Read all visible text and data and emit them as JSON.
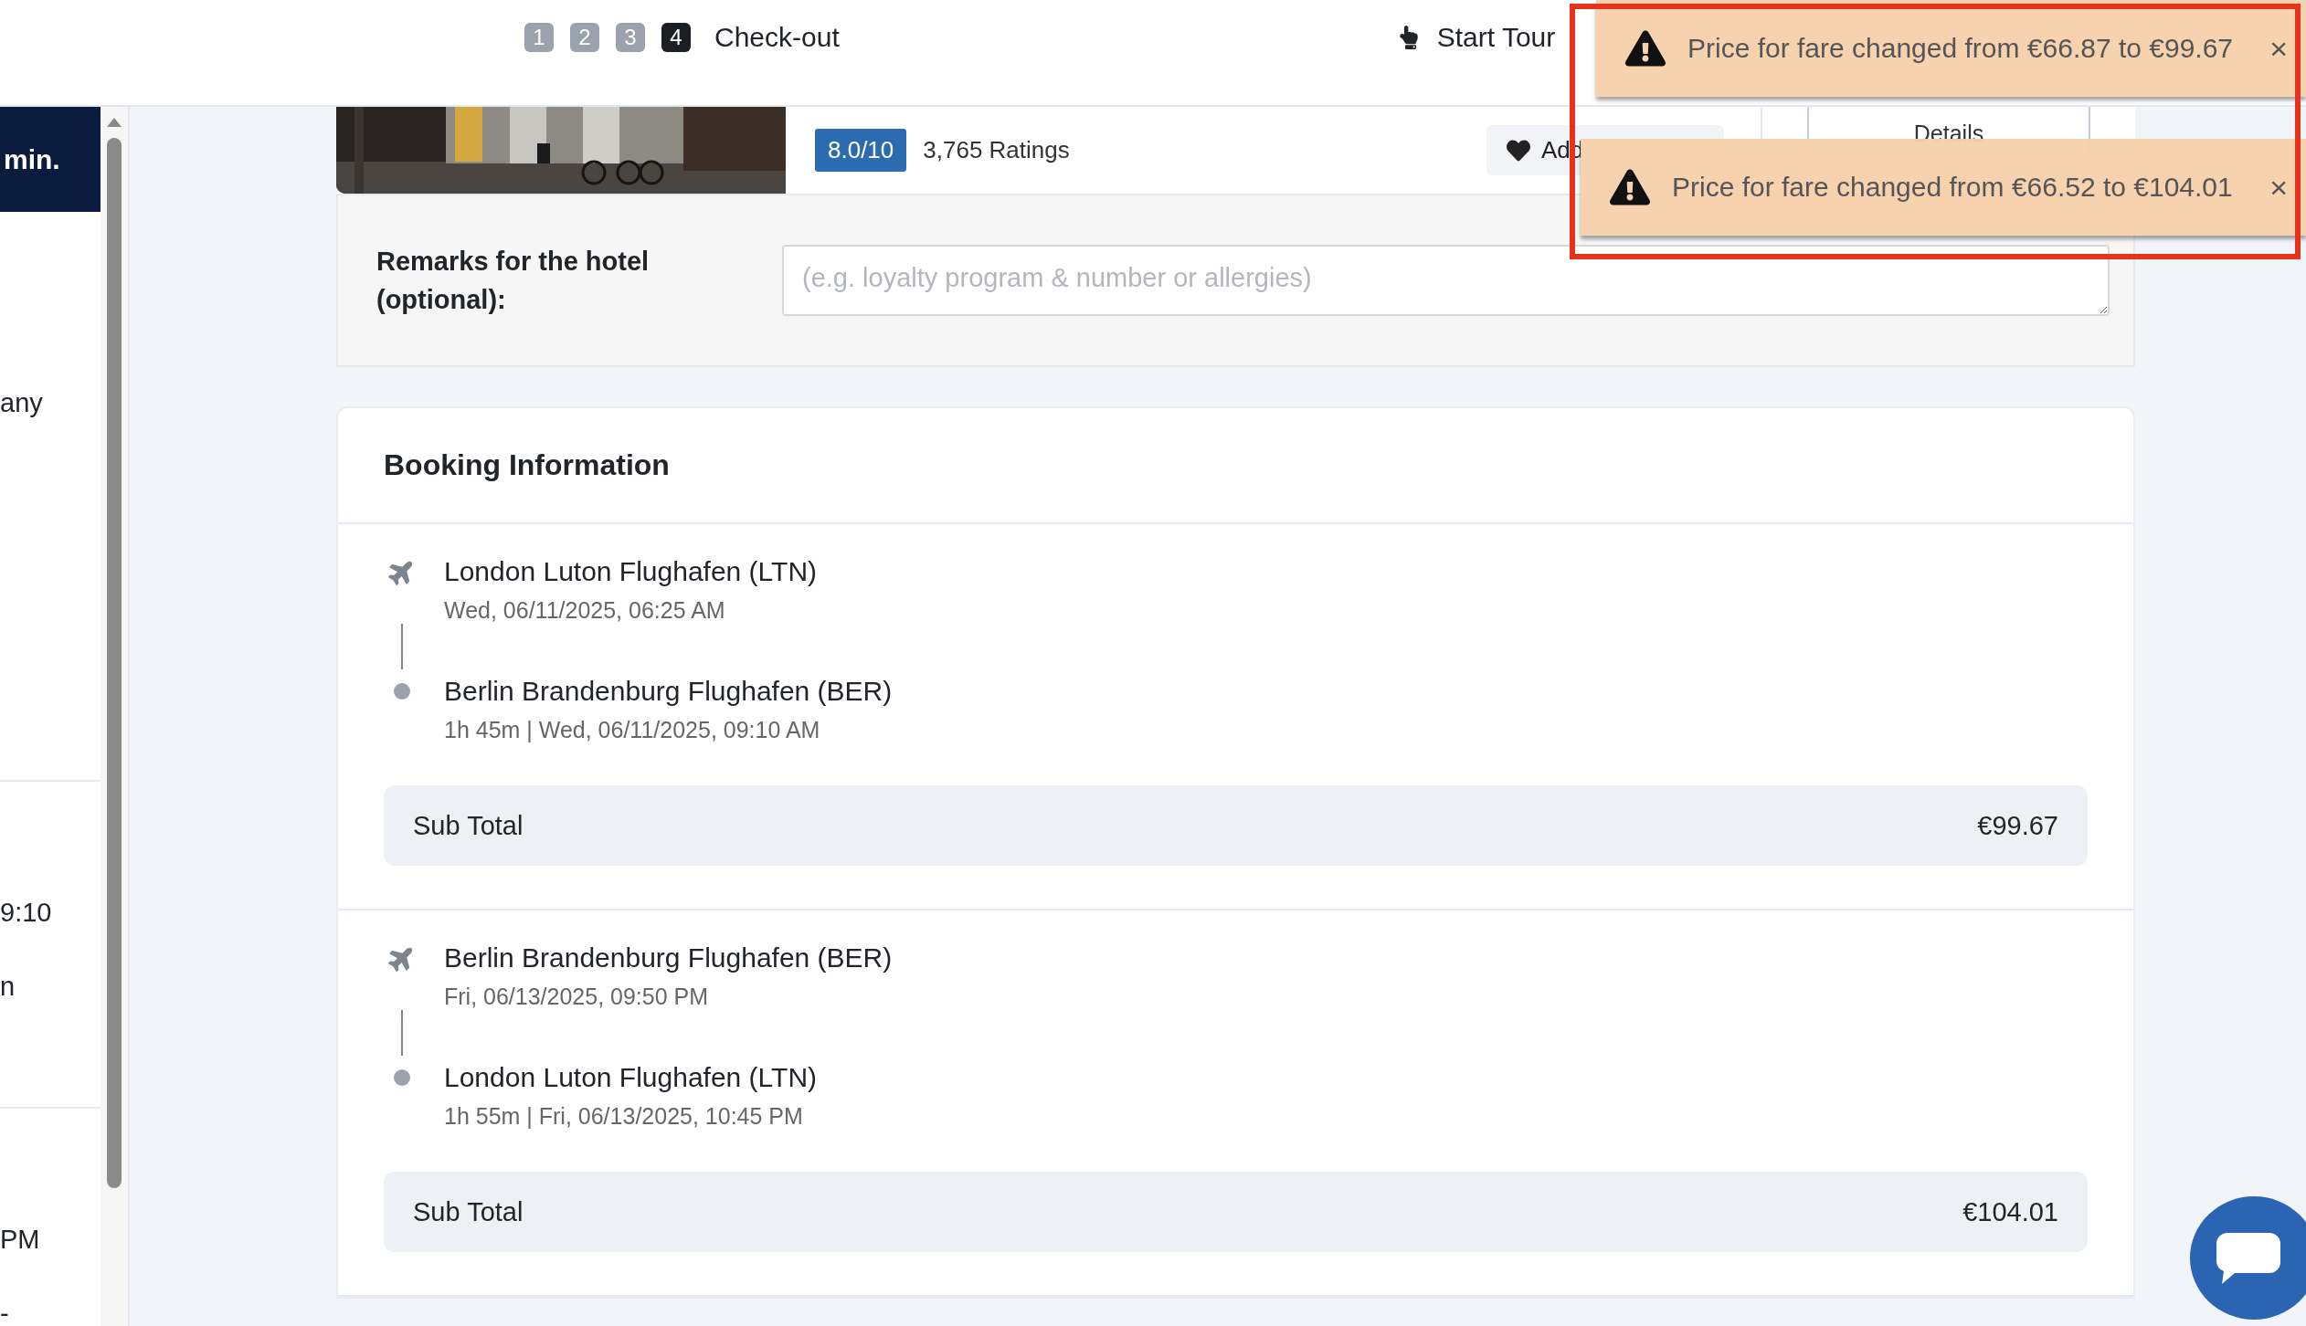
{
  "header": {
    "steps": [
      {
        "label": "1",
        "selected": false
      },
      {
        "label": "2",
        "selected": false
      },
      {
        "label": "3",
        "selected": false
      },
      {
        "label": "4",
        "selected": true
      }
    ],
    "current_step": "Check-out",
    "tour_button": "Start Tour"
  },
  "sidebar": {
    "banner": "min.",
    "sections": [
      {
        "lines": [
          "any"
        ]
      },
      {
        "lines": [
          "9:10",
          "n"
        ]
      },
      {
        "lines": [
          "PM",
          "-"
        ]
      }
    ]
  },
  "hotel": {
    "rating": "8.0/10",
    "ratings_count": "3,765 Ratings",
    "favorite_button": "Add",
    "details_button": "Details"
  },
  "remarks": {
    "label": "Remarks for the hotel (optional):",
    "placeholder": "(e.g. loyalty program & number or allergies)"
  },
  "booking": {
    "title": "Booking Information",
    "segments": [
      {
        "departure": {
          "airport": "London Luton Flughafen (LTN)",
          "time": "Wed, 06/11/2025, 06:25 AM"
        },
        "arrival": {
          "airport": "Berlin Brandenburg Flughafen (BER)",
          "time": "1h 45m | Wed, 06/11/2025, 09:10 AM"
        },
        "subtotal_label": "Sub Total",
        "subtotal": "€99.67"
      },
      {
        "departure": {
          "airport": "Berlin Brandenburg Flughafen (BER)",
          "time": "Fri, 06/13/2025, 09:50 PM"
        },
        "arrival": {
          "airport": "London Luton Flughafen (LTN)",
          "time": "1h 55m | Fri, 06/13/2025, 10:45 PM"
        },
        "subtotal_label": "Sub Total",
        "subtotal": "€104.01"
      }
    ]
  },
  "toasts": [
    {
      "message": "Price for fare changed from €66.87 to €99.67",
      "close": "×"
    },
    {
      "message": "Price for fare changed from €66.52 to €104.01",
      "close": "×"
    }
  ]
}
